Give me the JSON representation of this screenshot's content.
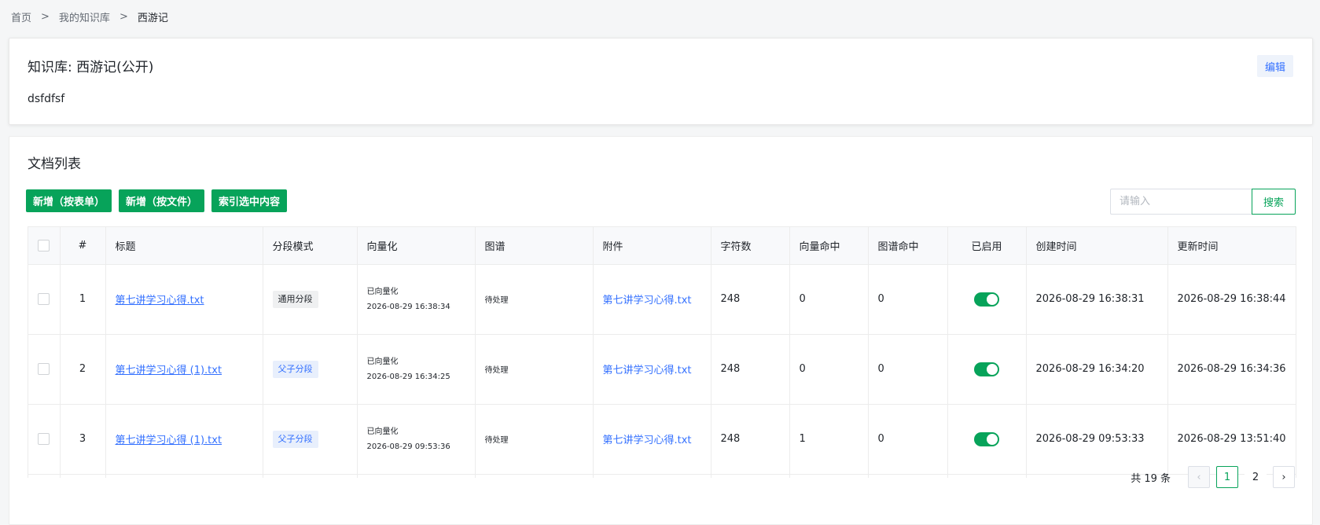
{
  "breadcrumb": {
    "home": "首页",
    "sep1": ">",
    "my_kb": "我的知识库",
    "sep2": ">",
    "current": "西游记"
  },
  "kb": {
    "title": "知识库: 西游记(公开)",
    "description": "dsfdfsf",
    "edit_label": "编辑"
  },
  "doc_list": {
    "title": "文档列表",
    "buttons": {
      "add_form": "新增（按表单）",
      "add_file": "新增（按文件）",
      "index_selected": "索引选中内容"
    },
    "search": {
      "placeholder": "请输入",
      "button_label": "搜索"
    },
    "columns": [
      "",
      "#",
      "标题",
      "分段模式",
      "向量化",
      "图谱",
      "附件",
      "字符数",
      "向量命中",
      "图谱命中",
      "已启用",
      "创建时间",
      "更新时间"
    ],
    "rows": [
      {
        "index": "1",
        "title": "第七讲学习心得.txt",
        "segment_mode": "通用分段",
        "segment_style": "gray",
        "vector_status": "已向量化",
        "vector_time": "2026-08-29 16:38:34",
        "graph": "待处理",
        "attachment": "第七讲学习心得.txt",
        "chars": "248",
        "vector_hits": "0",
        "graph_hits": "0",
        "enabled": true,
        "created": "2026-08-29 16:38:31",
        "updated": "2026-08-29 16:38:44"
      },
      {
        "index": "2",
        "title": "第七讲学习心得 (1).txt",
        "segment_mode": "父子分段",
        "segment_style": "blue",
        "vector_status": "已向量化",
        "vector_time": "2026-08-29 16:34:25",
        "graph": "待处理",
        "attachment": "第七讲学习心得.txt",
        "chars": "248",
        "vector_hits": "0",
        "graph_hits": "0",
        "enabled": true,
        "created": "2026-08-29 16:34:20",
        "updated": "2026-08-29 16:34:36"
      },
      {
        "index": "3",
        "title": "第七讲学习心得 (1).txt",
        "segment_mode": "父子分段",
        "segment_style": "blue",
        "vector_status": "已向量化",
        "vector_time": "2026-08-29 09:53:36",
        "graph": "待处理",
        "attachment": "第七讲学习心得.txt",
        "chars": "248",
        "vector_hits": "1",
        "graph_hits": "0",
        "enabled": true,
        "created": "2026-08-29 09:53:33",
        "updated": "2026-08-29 13:51:40"
      }
    ],
    "pagination": {
      "total": "共 19 条",
      "pages": [
        "1",
        "2"
      ],
      "current": "1"
    }
  },
  "colors": {
    "primary_green": "#07a35a",
    "link_blue": "#3370ff"
  },
  "icons": {
    "prev": "chevron-left-icon",
    "next": "chevron-right-icon"
  }
}
